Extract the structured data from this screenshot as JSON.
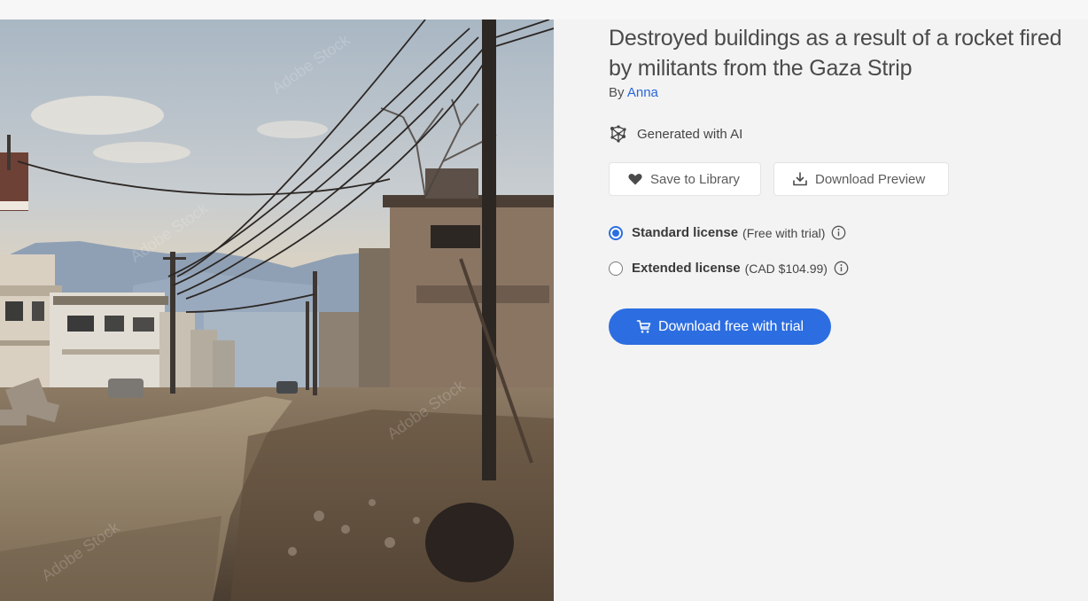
{
  "asset": {
    "title": "Destroyed buildings as a result of a rocket fired by militants from the Gaza Strip",
    "by_label": "By",
    "author": "Anna",
    "ai_badge": "Generated with AI",
    "watermark_text": "Adobe Stock"
  },
  "actions": {
    "save_label": "Save to Library",
    "download_preview_label": "Download Preview",
    "primary_label": "Download free with trial"
  },
  "licenses": [
    {
      "name": "Standard license",
      "note": "(Free with trial)",
      "selected": true
    },
    {
      "name": "Extended license",
      "note": "(CAD $104.99)",
      "selected": false
    }
  ],
  "icons": {
    "ai": "ai-sparkle-network-icon",
    "save": "heart-icon",
    "download": "download-tray-icon",
    "info": "info-circle-icon",
    "cart": "cart-icon"
  },
  "colors": {
    "accent": "#2c6ee1",
    "link": "#2a66d8",
    "panel_bg": "#f3f3f3"
  }
}
